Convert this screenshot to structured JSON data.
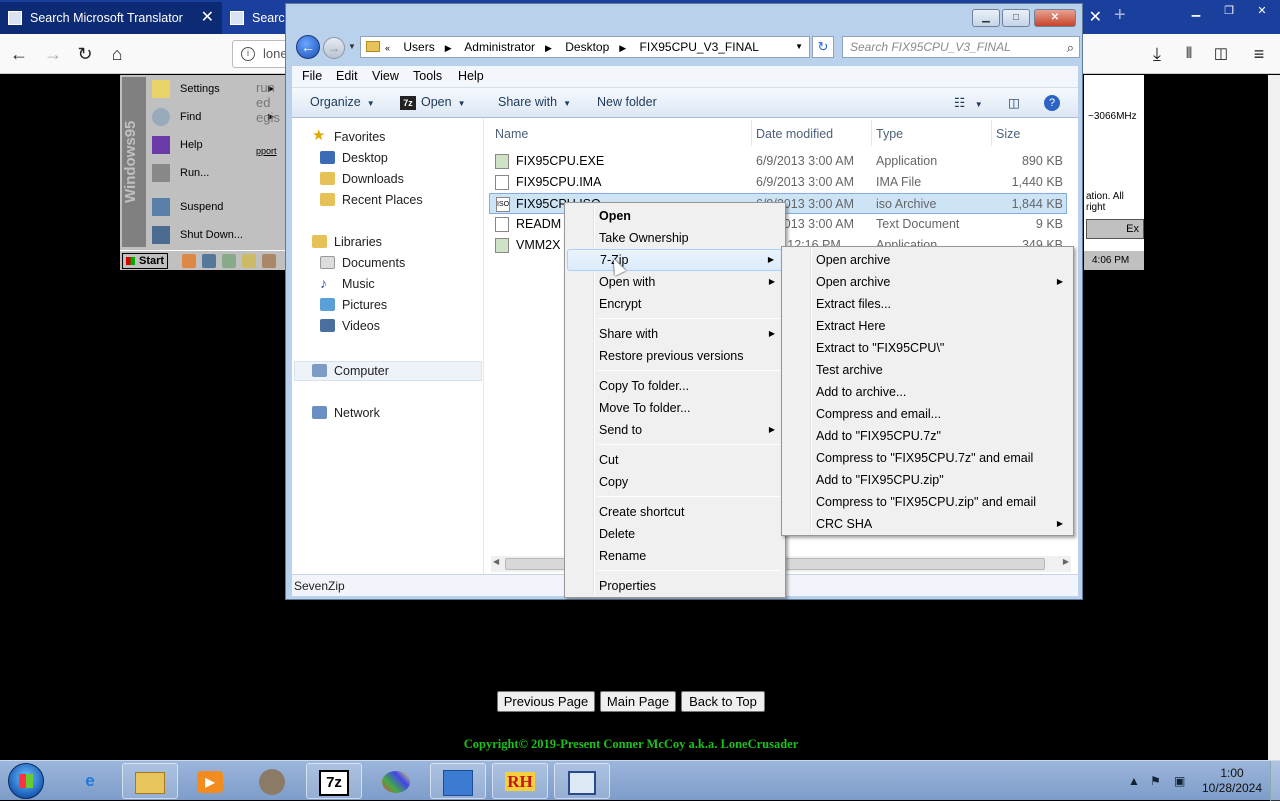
{
  "browser": {
    "tabs": [
      {
        "label": "Search Microsoft Translator",
        "active": true
      },
      {
        "label": "Search"
      }
    ],
    "url_partial": "lone"
  },
  "win95": {
    "menu": [
      {
        "label": "Settings",
        "icon": "settings-folder-icon",
        "submenu": true
      },
      {
        "label": "Find",
        "icon": "find-magnifier-icon",
        "submenu": true
      },
      {
        "label": "Help",
        "icon": "help-book-icon"
      },
      {
        "label": "Run...",
        "icon": "run-icon"
      },
      {
        "label": "Suspend",
        "icon": "suspend-icon"
      },
      {
        "label": "Shut Down...",
        "icon": "shutdown-icon"
      }
    ],
    "band_text": "Windows95",
    "start_label": "Start",
    "tray_time": "4:06 PM",
    "cpu_text": "~3066MHz",
    "rights_text": "ation. All right",
    "ex_button": "Ex",
    "behind_text": [
      "run",
      "ed",
      "egis"
    ],
    "behind_link": "pport"
  },
  "explorer": {
    "breadcrumb": [
      "Users",
      "Administrator",
      "Desktop",
      "FIX95CPU_V3_FINAL"
    ],
    "search_placeholder": "Search FIX95CPU_V3_FINAL",
    "menubar": [
      "File",
      "Edit",
      "View",
      "Tools",
      "Help"
    ],
    "toolbar": {
      "organize": "Organize",
      "open": "Open",
      "share_with": "Share with",
      "new_folder": "New folder"
    },
    "nav": {
      "favorites": "Favorites",
      "desktop": "Desktop",
      "downloads": "Downloads",
      "recent": "Recent Places",
      "libraries": "Libraries",
      "documents": "Documents",
      "music": "Music",
      "pictures": "Pictures",
      "videos": "Videos",
      "computer": "Computer",
      "network": "Network"
    },
    "columns": {
      "name": "Name",
      "date": "Date modified",
      "type": "Type",
      "size": "Size"
    },
    "files": [
      {
        "name": "FIX95CPU.EXE",
        "date": "6/9/2013 3:00 AM",
        "type": "Application",
        "size": "890 KB"
      },
      {
        "name": "FIX95CPU.IMA",
        "date": "6/9/2013 3:00 AM",
        "type": "IMA File",
        "size": "1,440 KB"
      },
      {
        "name": "FIX95CPU.ISO",
        "date": "6/9/2013 3:00 AM",
        "type": "iso Archive",
        "size": "1,844 KB"
      },
      {
        "name": "READM",
        "date": "6/9/2013 3:00 AM",
        "type": "Text Document",
        "size": "9 KB"
      },
      {
        "name": "VMM2X",
        "date": "1998 12:16 PM",
        "type": "Application",
        "size": "349 KB"
      }
    ],
    "status": "SevenZip"
  },
  "context_menu": {
    "items": [
      "Open",
      "Take Ownership",
      "7-Zip",
      "Open with",
      "Encrypt",
      "Share with",
      "Restore previous versions",
      "Copy To folder...",
      "Move To folder...",
      "Send to",
      "Cut",
      "Copy",
      "Create shortcut",
      "Delete",
      "Rename",
      "Properties"
    ]
  },
  "zip_menu": {
    "items": [
      "Open archive",
      "Open archive",
      "Extract files...",
      "Extract Here",
      "Extract to \"FIX95CPU\\\"",
      "Test archive",
      "Add to archive...",
      "Compress and email...",
      "Add to \"FIX95CPU.7z\"",
      "Compress to \"FIX95CPU.7z\" and email",
      "Add to \"FIX95CPU.zip\"",
      "Compress to \"FIX95CPU.zip\" and email",
      "CRC SHA"
    ]
  },
  "page": {
    "buttons": [
      "Previous Page",
      "Main Page",
      "Back to Top"
    ],
    "copyright": "Copyright© 2019-Present Conner McCoy a.k.a. LoneCrusader"
  },
  "taskbar": {
    "pinned": [
      "internet-explorer-icon",
      "windows-explorer-icon",
      "media-player-icon",
      "raccoon-app-icon",
      "7zip-icon",
      "paint-icon",
      "control-panel-icon",
      "resource-hacker-icon",
      "virtual-machine-icon"
    ],
    "sevenzip_label": "7z",
    "rh_label": "RH",
    "time": "1:00",
    "date": "10/28/2024"
  }
}
